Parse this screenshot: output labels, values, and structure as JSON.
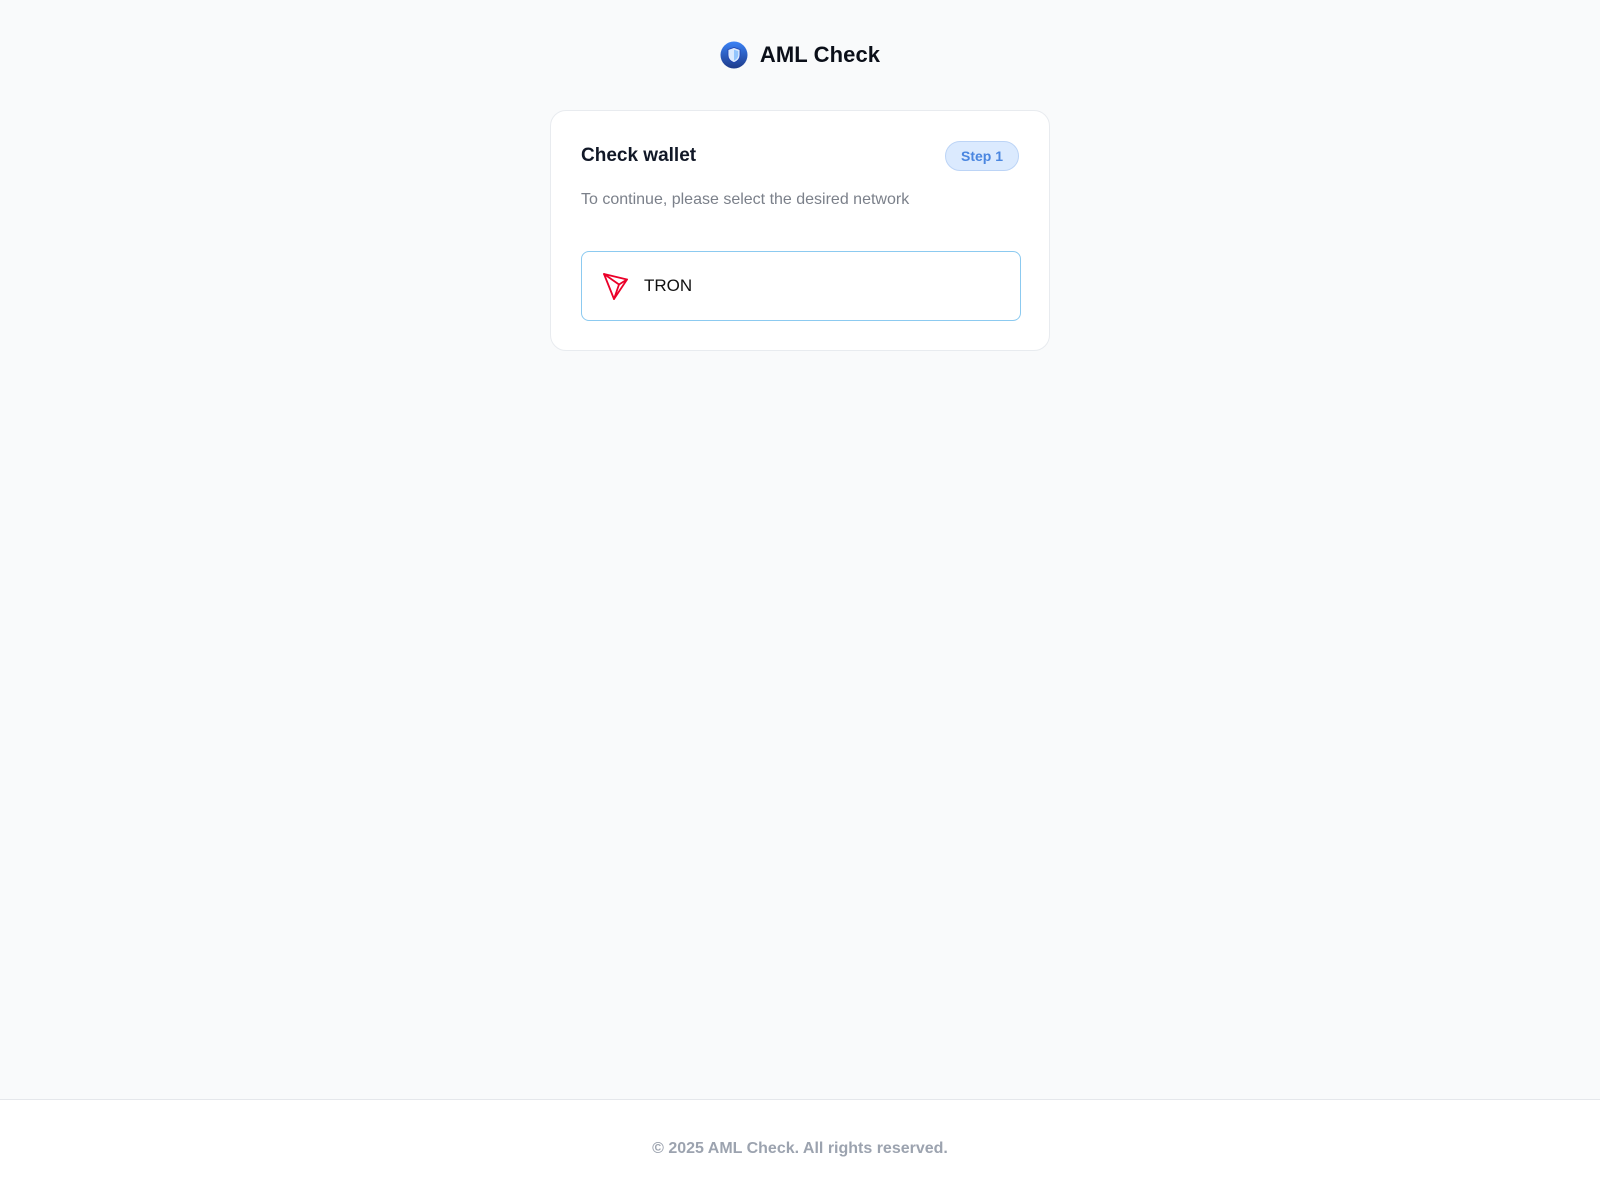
{
  "header": {
    "logo_icon": "shield-icon",
    "brand_name": "AML Check"
  },
  "card": {
    "title": "Check wallet",
    "step_badge": "Step 1",
    "subtitle": "To continue, please select the desired network",
    "networks": [
      {
        "icon": "tron-icon",
        "label": "TRON",
        "icon_color": "#eb0029"
      }
    ]
  },
  "footer": {
    "copyright": "© 2025 AML Check. All rights reserved."
  },
  "colors": {
    "background": "#f9fafb",
    "accent": "#4a86e0",
    "badge_bg": "#dbeafe",
    "option_border": "#8ccaf0",
    "tron_red": "#eb0029",
    "logo_blue": "#1d4ed8"
  }
}
